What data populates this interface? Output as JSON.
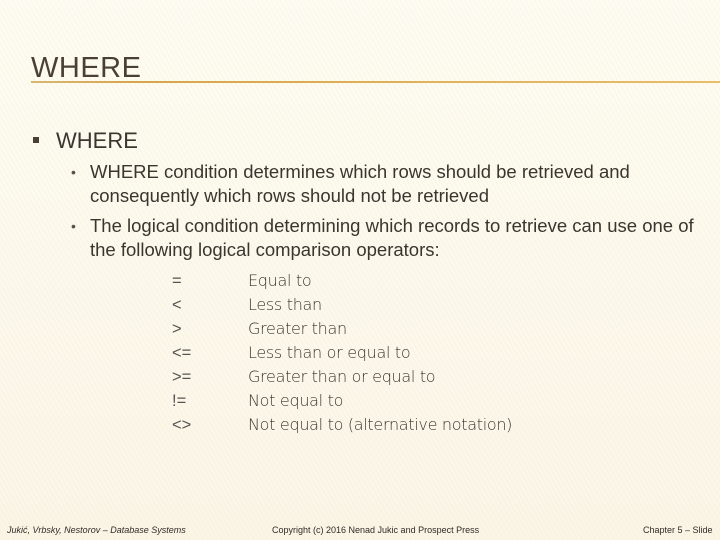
{
  "slide": {
    "title": "WHERE",
    "accent_color": "#d7a54c",
    "level1": {
      "bullet_icon": "square-bullet",
      "text": "WHERE"
    },
    "level2": [
      {
        "bullet_icon": "dot-bullet",
        "text": "WHERE condition determines which rows should be retrieved and consequently which rows should not be retrieved"
      },
      {
        "bullet_icon": "dot-bullet",
        "text": "The logical condition determining which records to retrieve can use one of the following logical comparison operators:"
      }
    ],
    "operators": [
      {
        "symbol": "=",
        "description": "Equal to"
      },
      {
        "symbol": "<",
        "description": "Less than"
      },
      {
        "symbol": ">",
        "description": "Greater than"
      },
      {
        "symbol": "<=",
        "description": "Less than or equal to"
      },
      {
        "symbol": ">=",
        "description": "Greater than or equal to"
      },
      {
        "symbol": "!=",
        "description": "Not equal to"
      },
      {
        "symbol": "<>",
        "description": "Not equal to (alternative notation)"
      }
    ]
  },
  "footer": {
    "left": "Jukić, Vrbsky, Nestorov – Database Systems",
    "center": "Copyright (c) 2016 Nenad Jukic and Prospect Press",
    "right": "Chapter 5 – Slide"
  }
}
